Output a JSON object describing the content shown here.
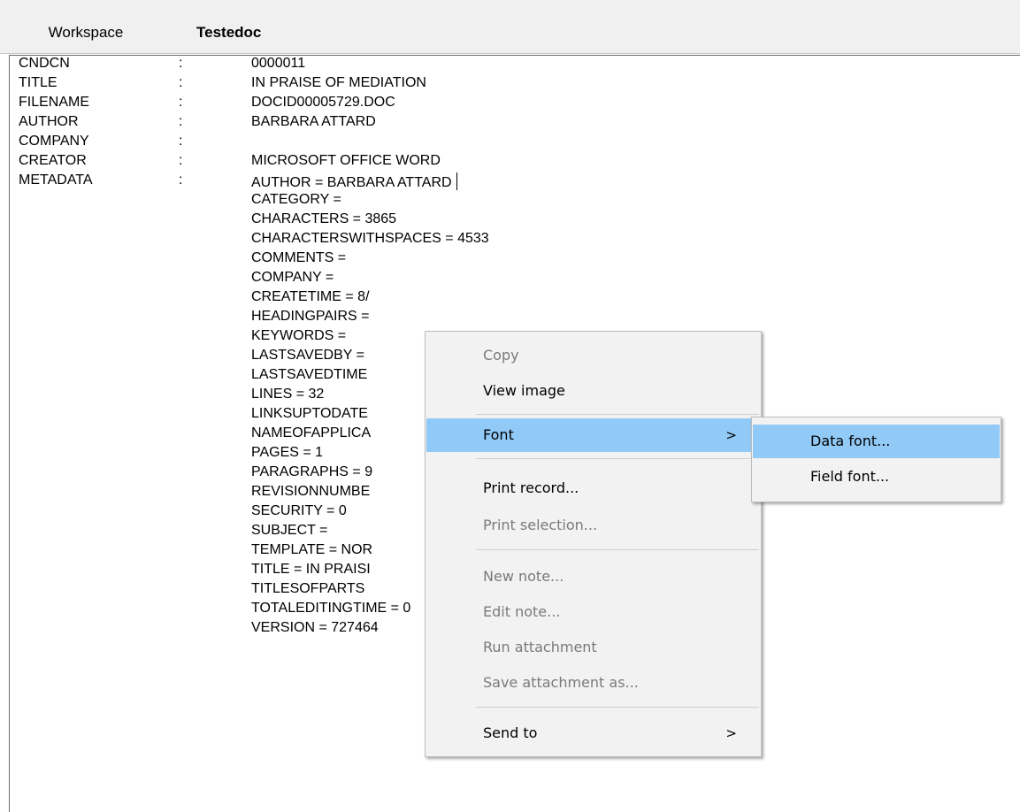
{
  "tabs": {
    "workspace": "Workspace",
    "document": "Testedoc"
  },
  "fields": [
    {
      "name": "CNDCN",
      "value": "0000011"
    },
    {
      "name": "TITLE",
      "value": "IN PRAISE OF MEDIATION"
    },
    {
      "name": "FILENAME",
      "value": "DOCID00005729.DOC"
    },
    {
      "name": "AUTHOR",
      "value": "BARBARA ATTARD"
    },
    {
      "name": "COMPANY",
      "value": ""
    },
    {
      "name": "CREATOR",
      "value": "MICROSOFT OFFICE WORD"
    },
    {
      "name": "METADATA",
      "value": "AUTHOR = BARBARA ATTARD"
    }
  ],
  "colon": ":",
  "metadata_lines": [
    "CATEGORY =",
    "CHARACTERS = 3865",
    "CHARACTERSWITHSPACES = 4533",
    "COMMENTS =",
    "COMPANY =",
    "CREATETIME = 8/",
    "HEADINGPAIRS =",
    "KEYWORDS =",
    "LASTSAVEDBY =",
    "LASTSAVEDTIME",
    "LINES = 32",
    "LINKSUPTODATE",
    "NAMEOFAPPLICA",
    "PAGES = 1",
    "PARAGRAPHS = 9",
    "REVISIONNUMBE",
    "SECURITY = 0",
    "SUBJECT =",
    "TEMPLATE = NOR",
    "TITLE = IN PRAISI",
    "TITLESOFPARTS",
    "TOTALEDITINGTIME = 0",
    "VERSION = 727464"
  ],
  "context_menu": {
    "copy": "Copy",
    "view_image": "View image",
    "font": "Font",
    "print_record": "Print record...",
    "print_selection": "Print selection...",
    "new_note": "New note...",
    "edit_note": "Edit note...",
    "run_attachment": "Run attachment",
    "save_attachment": "Save attachment as...",
    "send_to": "Send to",
    "submenu_arrow": ">"
  },
  "font_submenu": {
    "data_font": "Data font...",
    "field_font": "Field font..."
  },
  "colors": {
    "highlight": "#91c9f7",
    "menu_bg": "#f2f2f2",
    "disabled_text": "#7a7a7a"
  }
}
